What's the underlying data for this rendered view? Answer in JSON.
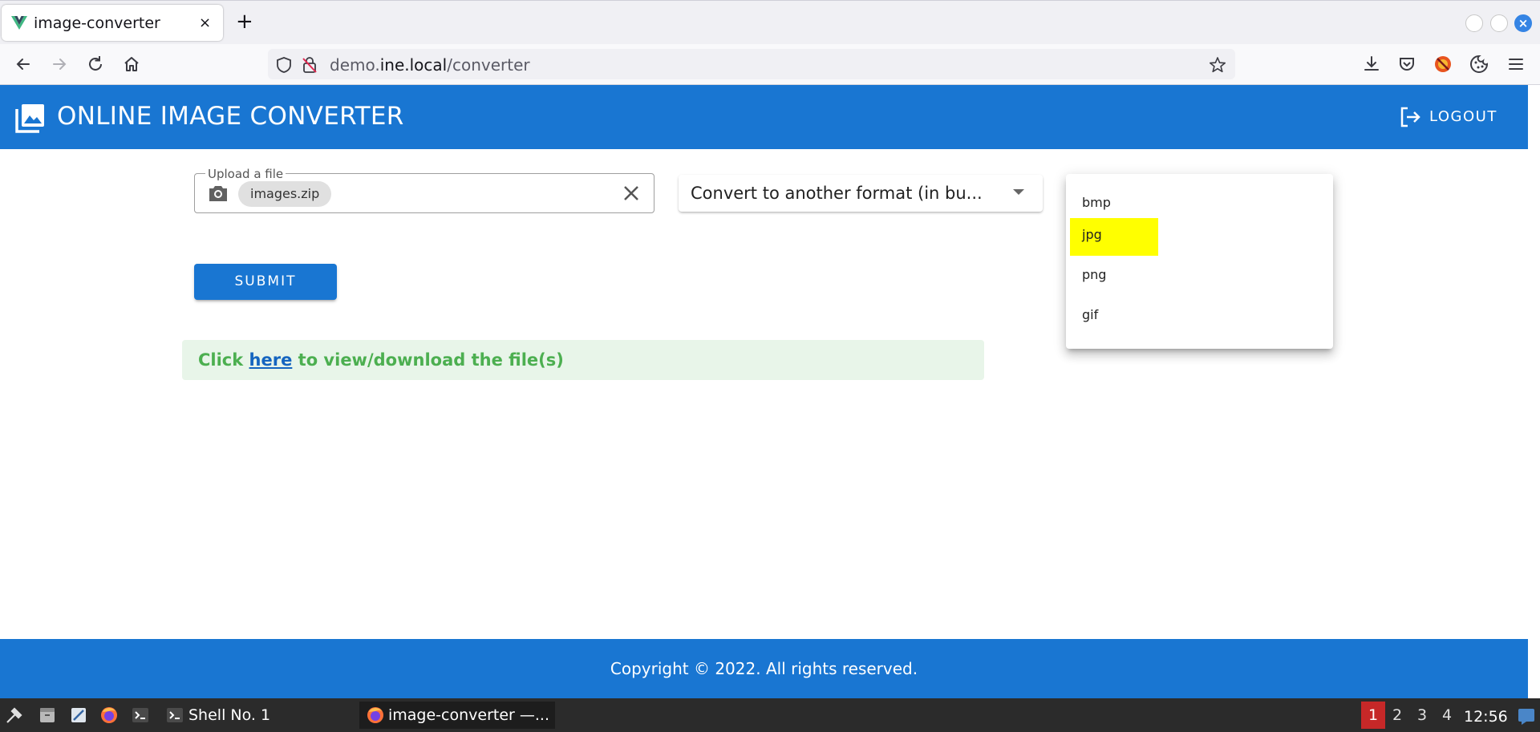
{
  "browser": {
    "tab_title": "image-converter",
    "tab_close": "×",
    "new_tab": "+",
    "url_prefix": "demo.",
    "url_domain": "ine.local",
    "url_path": "/converter",
    "window_close_glyph": "×"
  },
  "header": {
    "title": "ONLINE IMAGE CONVERTER",
    "logout_label": "LOGOUT"
  },
  "upload": {
    "label": "Upload a file",
    "file_chip": "images.zip"
  },
  "convert_select": {
    "value": "Convert to another format (in bu..."
  },
  "format_menu": {
    "options": [
      "bmp",
      "jpg",
      "png",
      "gif"
    ],
    "highlighted": "jpg"
  },
  "submit_label": "SUBMIT",
  "alert": {
    "prefix": "Click ",
    "link": "here",
    "suffix": " to view/download the file(s)"
  },
  "footer": {
    "copyright": "Copyright © 2022. All rights reserved."
  },
  "taskbar": {
    "task_terminal": "Shell No. 1",
    "task_browser": "image-converter —...",
    "workspaces": [
      "1",
      "2",
      "3",
      "4"
    ],
    "active_workspace": "1",
    "clock": "12:56"
  },
  "colors": {
    "primary": "#1976d2",
    "alert_bg": "#e8f5e9",
    "alert_text": "#4caf50",
    "highlight": "#ffff00",
    "taskbar": "#2b2b2b",
    "active_workspace": "#c62828"
  }
}
